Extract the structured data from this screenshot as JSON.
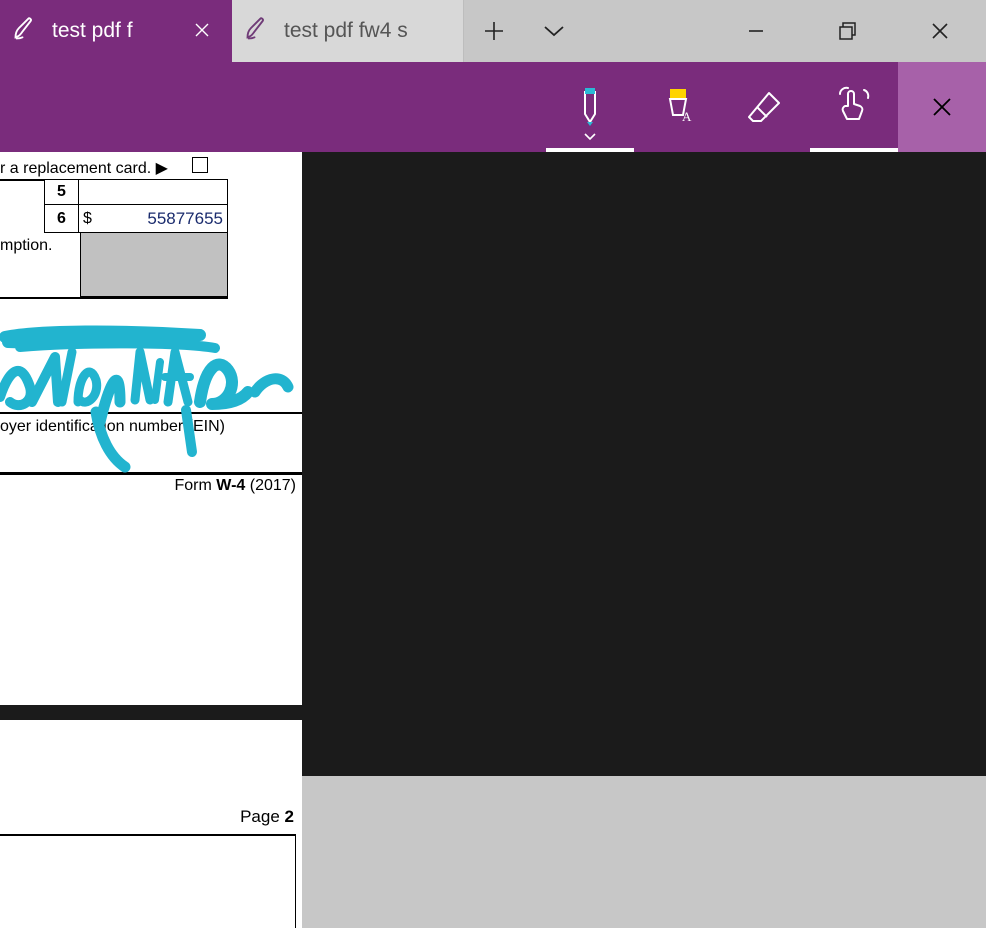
{
  "tabs": [
    {
      "label": "test pdf f",
      "active": true
    },
    {
      "label": "test pdf fw4 s",
      "active": false
    }
  ],
  "toolbar": {
    "pen": "Ballpoint pen",
    "highlighter": "Highlighter",
    "eraser": "Eraser",
    "touch": "Touch writing",
    "close": "Close ink toolbar"
  },
  "document": {
    "replacement_text": "r a replacement card.  ▶",
    "row5_num": "5",
    "row6_num": "6",
    "row6_dollar": "$",
    "row6_value": "55877655",
    "mption_text": "mption.",
    "ein_text": "oyer identification number (EIN)",
    "form_label_pre": "Form ",
    "form_label_bold": "W-4",
    "form_label_year": " (2017)",
    "page2_label_pre": "Page ",
    "page2_label_num": "2"
  },
  "colors": {
    "brand": "#7a2c7c",
    "ink": "#2bb9d6"
  }
}
